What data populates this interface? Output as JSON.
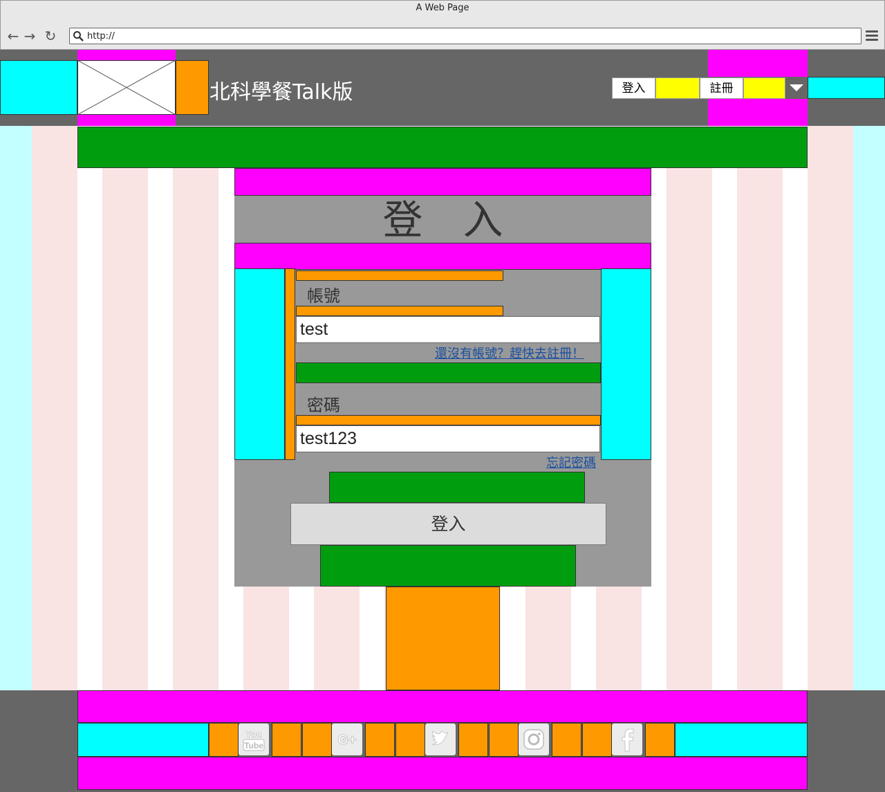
{
  "window": {
    "title": "A Web Page",
    "url": "http://"
  },
  "header": {
    "site_title": "北科學餐Talk版",
    "login_label": "登入",
    "register_label": "註冊"
  },
  "login": {
    "heading": "登　入",
    "account_label": "帳號",
    "account_value": "test",
    "register_link": "還沒有帳號？趕快去註冊！",
    "password_label": "密碼",
    "password_value": "test123",
    "forgot_link": "忘記密碼",
    "submit_label": "登入"
  },
  "footer": {
    "social_icons": [
      "youtube-icon",
      "google-plus-icon",
      "twitter-icon",
      "instagram-icon",
      "facebook-icon"
    ]
  },
  "colors": {
    "magenta": "#ff00ff",
    "cyan": "#00ffff",
    "orange": "#ff9900",
    "green": "#009e0f",
    "yellow": "#ffff00",
    "header_gray": "#666666",
    "panel_gray": "#999999"
  }
}
